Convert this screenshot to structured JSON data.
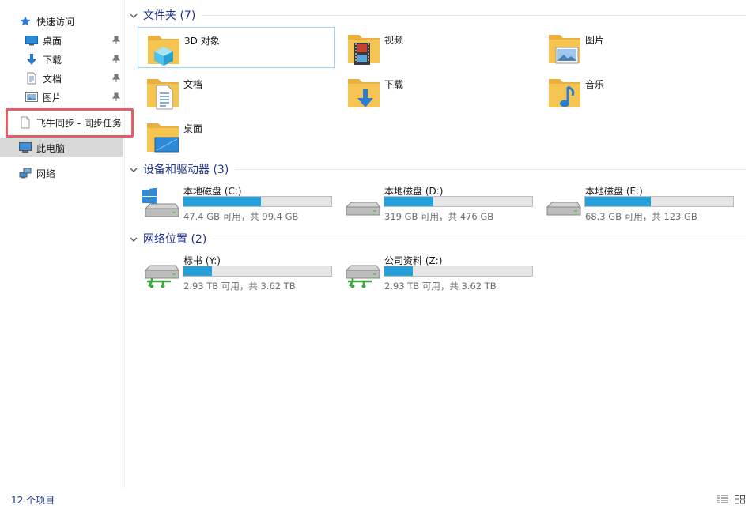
{
  "sidebar": {
    "quick_access": "快速访问",
    "items": [
      {
        "label": "桌面",
        "icon": "desktop-icon"
      },
      {
        "label": "下载",
        "icon": "download-icon"
      },
      {
        "label": "文档",
        "icon": "documents-icon"
      },
      {
        "label": "图片",
        "icon": "pictures-icon"
      }
    ],
    "feiniu": "飞牛同步 - 同步任务",
    "this_pc": "此电脑",
    "network": "网络"
  },
  "groups": {
    "folders_title": "文件夹 (7)",
    "drives_title": "设备和驱动器 (3)",
    "network_title": "网络位置 (2)"
  },
  "folders": [
    {
      "label": "3D 对象",
      "icon": "3d-objects-folder-icon"
    },
    {
      "label": "视频",
      "icon": "videos-folder-icon"
    },
    {
      "label": "图片",
      "icon": "pictures-folder-icon"
    },
    {
      "label": "文档",
      "icon": "documents-folder-icon"
    },
    {
      "label": "下载",
      "icon": "downloads-folder-icon"
    },
    {
      "label": "音乐",
      "icon": "music-folder-icon"
    },
    {
      "label": "桌面",
      "icon": "desktop-folder-icon"
    }
  ],
  "drives": [
    {
      "name": "本地磁盘 (C:)",
      "free": "47.4 GB 可用，共 99.4 GB",
      "used_fraction": 0.523
    },
    {
      "name": "本地磁盘 (D:)",
      "free": "319 GB 可用，共 476 GB",
      "used_fraction": 0.33
    },
    {
      "name": "本地磁盘 (E:)",
      "free": "68.3 GB 可用，共 123 GB",
      "used_fraction": 0.445
    }
  ],
  "network_drives": [
    {
      "name": "标书 (Y:)",
      "free": "2.93 TB 可用，共 3.62 TB",
      "used_fraction": 0.19
    },
    {
      "name": "公司资料 (Z:)",
      "free": "2.93 TB 可用，共 3.62 TB",
      "used_fraction": 0.19
    }
  ],
  "status": {
    "item_count": "12 个项目"
  },
  "colors": {
    "accent_text": "#1e3287",
    "bar_fill": "#26a0da",
    "highlight": "#e35f63",
    "folder": "#f5c451"
  }
}
